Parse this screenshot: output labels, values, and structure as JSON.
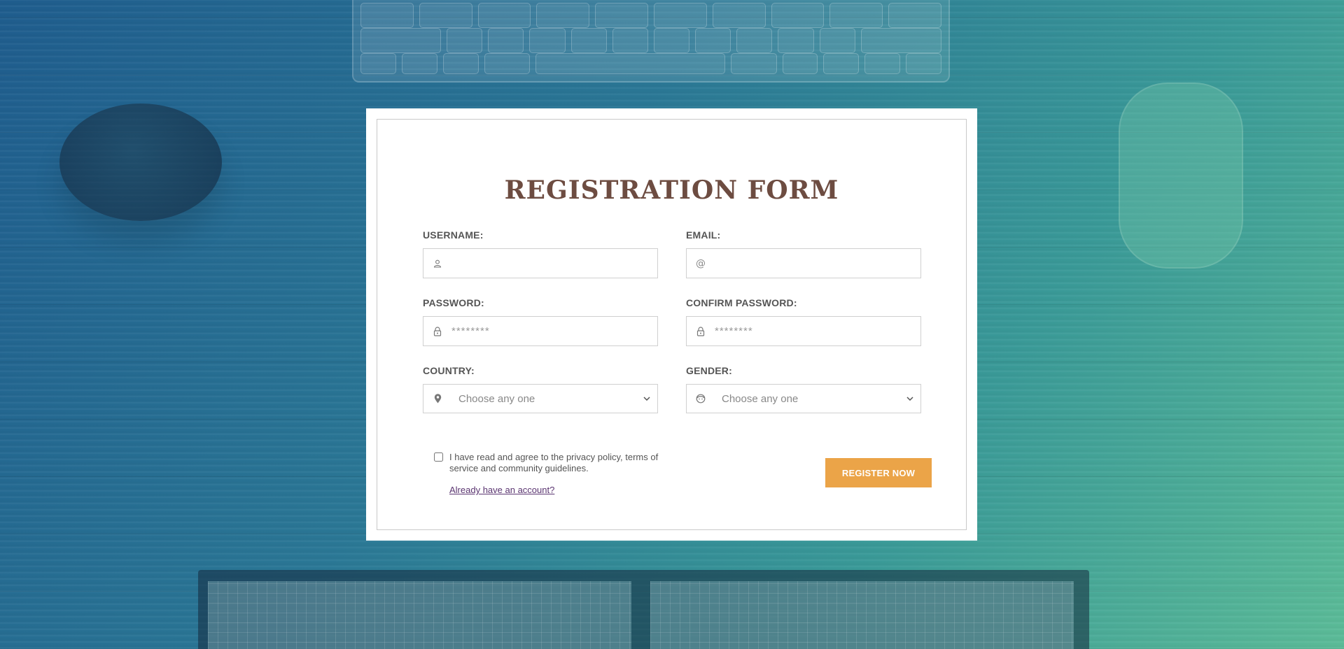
{
  "form": {
    "title": "REGISTRATION FORM",
    "username": {
      "label": "USERNAME:",
      "value": "",
      "placeholder": "",
      "icon": "user-icon"
    },
    "email": {
      "label": "EMAIL:",
      "value": "",
      "placeholder": "",
      "icon": "at-icon"
    },
    "password": {
      "label": "PASSWORD:",
      "value": "",
      "placeholder": "********",
      "icon": "lock-icon"
    },
    "confirm_password": {
      "label": "CONFIRM PASSWORD:",
      "value": "",
      "placeholder": "********",
      "icon": "lock-icon"
    },
    "country": {
      "label": "COUNTRY:",
      "selected": "Choose any one",
      "icon": "map-pin-icon"
    },
    "gender": {
      "label": "GENDER:",
      "selected": "Choose any one",
      "icon": "face-icon"
    },
    "agree_text": "I have read and agree to the privacy policy, terms of service and community guidelines.",
    "agree_checked": false,
    "login_link": "Already have an account?",
    "submit_label": "REGISTER NOW"
  },
  "colors": {
    "title": "#6d4c41",
    "button": "#eba448",
    "link": "#5a3470",
    "background_start": "#1f5d8e",
    "background_end": "#5cbc98"
  }
}
